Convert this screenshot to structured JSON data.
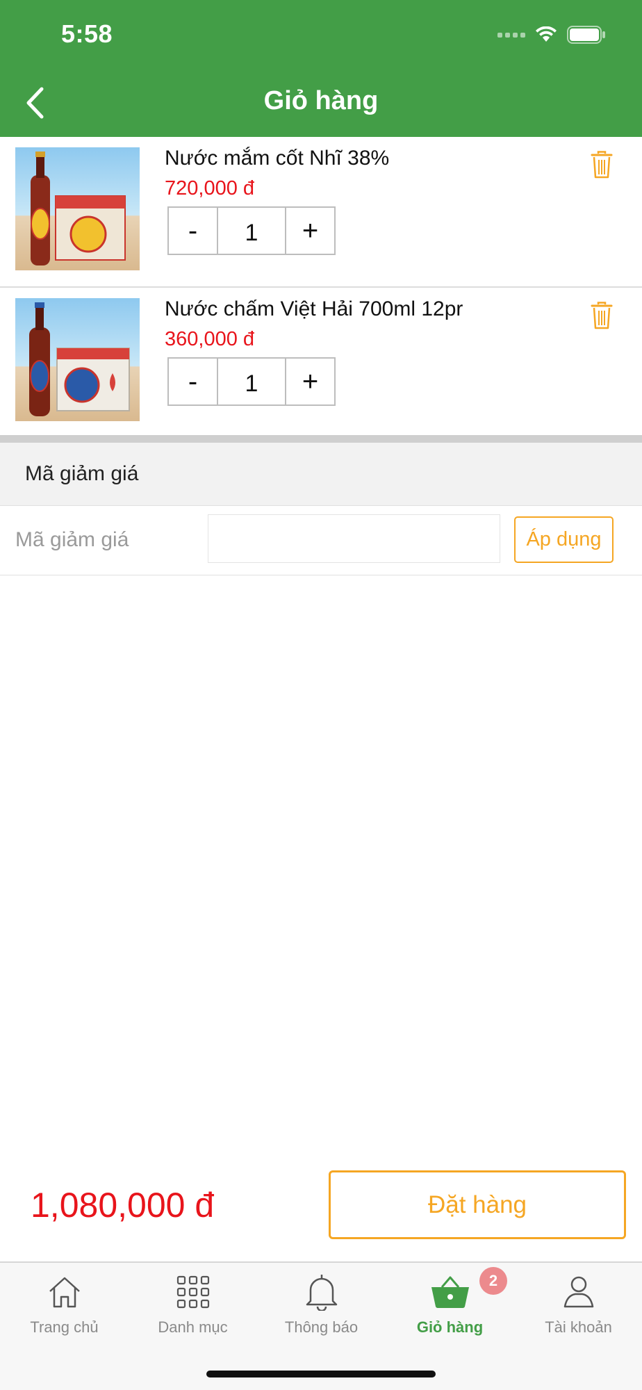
{
  "status_bar": {
    "time": "5:58"
  },
  "header": {
    "title": "Giỏ hàng"
  },
  "cart": {
    "items": [
      {
        "name": "Nước mắm cốt Nhĩ 38%",
        "price": "720,000 đ",
        "quantity": "1",
        "minus": "-",
        "plus": "+"
      },
      {
        "name": "Nước chấm Việt Hải 700ml 12pr",
        "price": "360,000 đ",
        "quantity": "1",
        "minus": "-",
        "plus": "+"
      }
    ]
  },
  "discount": {
    "section_title": "Mã giảm giá",
    "label": "Mã giảm giá",
    "value": "",
    "apply_label": "Áp dụng"
  },
  "checkout": {
    "total": "1,080,000 đ",
    "order_label": "Đặt hàng"
  },
  "tabbar": {
    "tabs": [
      {
        "label": "Trang chủ",
        "icon": "home-icon"
      },
      {
        "label": "Danh mục",
        "icon": "grid-icon"
      },
      {
        "label": "Thông báo",
        "icon": "bell-icon"
      },
      {
        "label": "Giỏ hàng",
        "icon": "basket-icon",
        "active": true
      },
      {
        "label": "Tài khoản",
        "icon": "user-icon"
      }
    ],
    "cart_badge": "2"
  },
  "colors": {
    "brand_green": "#439e47",
    "accent_orange": "#f5a623",
    "price_red": "#e8141b",
    "badge_pink": "#ec8a8d"
  }
}
